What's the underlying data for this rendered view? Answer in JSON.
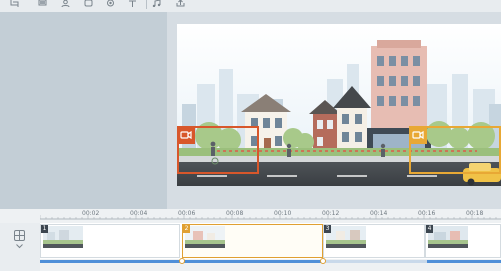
{
  "toolbar": {
    "icons": [
      "crop-icon",
      "layers-icon",
      "character-icon",
      "shape-icon",
      "sticker-icon",
      "text-icon",
      "music-icon",
      "export-icon"
    ]
  },
  "timeline": {
    "ticks": [
      "00:02",
      "00:04",
      "00:06",
      "00:08",
      "00:10",
      "00:12",
      "00:14",
      "00:16",
      "00:18"
    ],
    "scenes": [
      {
        "number": "1",
        "active": false
      },
      {
        "number": "2",
        "active": true
      },
      {
        "number": "3",
        "active": false
      },
      {
        "number": "4",
        "active": false
      }
    ]
  }
}
